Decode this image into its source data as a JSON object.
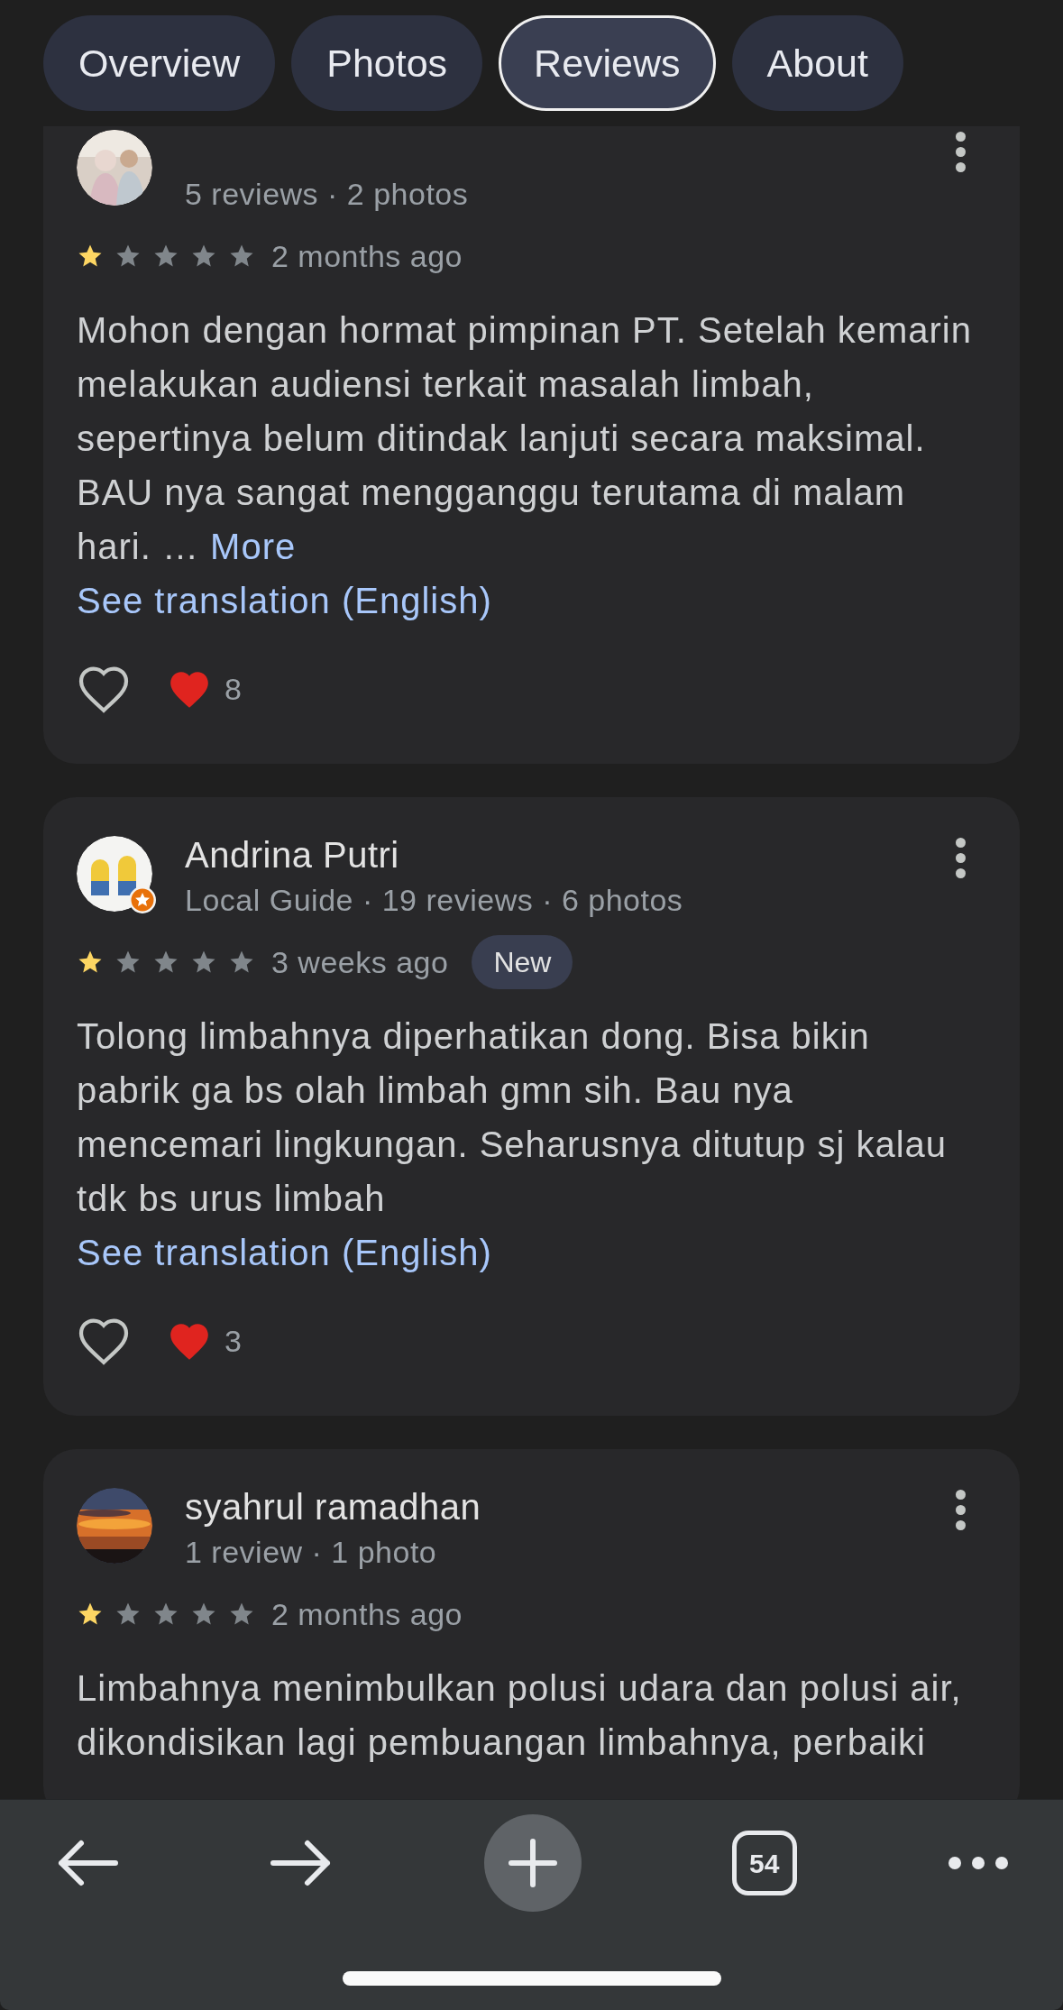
{
  "tabs": [
    {
      "label": "Overview",
      "selected": false
    },
    {
      "label": "Photos",
      "selected": false
    },
    {
      "label": "Reviews",
      "selected": true
    },
    {
      "label": "About",
      "selected": false
    }
  ],
  "reviews": [
    {
      "local_guide": false,
      "meta": "5 reviews · 2 photos",
      "stars": 1,
      "time": "2 months ago",
      "text": "Mohon dengan hormat pimpinan PT. Setelah kemarin melakukan audiensi terkait masalah limbah, sepertinya belum ditindak lanjuti secara maksimal. BAU nya sangat mengganggu terutama di malam hari. …",
      "more": "More",
      "translation": "See translation (English)",
      "liked": false,
      "reaction_count": "8"
    },
    {
      "name": "Andrina Putri",
      "local_guide": true,
      "meta": "Local Guide · 19 reviews · 6 photos",
      "stars": 1,
      "time": "3 weeks ago",
      "badge": "New",
      "text": "Tolong limbahnya diperhatikan dong. Bisa bikin pabrik ga bs olah limbah gmn sih. Bau nya mencemari lingkungan. Seharusnya ditutup sj kalau tdk bs urus limbah",
      "translation": "See translation (English)",
      "liked": false,
      "reaction_count": "3"
    },
    {
      "name": "syahrul ramadhan",
      "local_guide": false,
      "meta": "1 review · 1 photo",
      "stars": 1,
      "time": "2 months ago",
      "text": "Limbahnya menimbulkan polusi udara dan polusi air, dikondisikan lagi pembuangan limbahnya, perbaiki"
    }
  ],
  "bottom_bar": {
    "tab_count": "54"
  }
}
